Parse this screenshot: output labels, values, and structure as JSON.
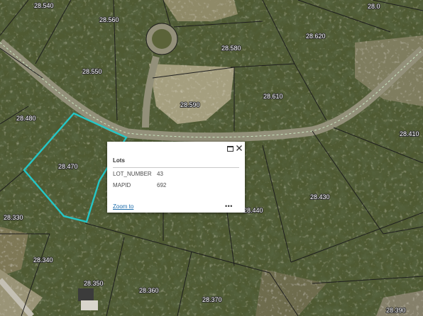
{
  "map": {
    "parcel_labels": [
      "28.540",
      "28.560",
      "28.0",
      "28.620",
      "28.580",
      "28.550",
      "28.610",
      "28.590",
      "28.480",
      "28.410",
      "28.470",
      "28.430",
      "28.440",
      "28.330",
      "28.340",
      "28.350",
      "28.360",
      "28.370",
      "28.390"
    ],
    "colors": {
      "highlight": "#24c7c7",
      "parcel_line": "#1e1e1e",
      "road_line": "#c9e6c0",
      "forest_dark": "#2f3a1f",
      "clearing": "#b9ae8c"
    }
  },
  "popup": {
    "title": "Lots",
    "attributes": [
      {
        "name": "LOT_NUMBER",
        "value": "43"
      },
      {
        "name": "MAPID",
        "value": "692"
      }
    ],
    "zoom_link": "Zoom to",
    "more_label": "•••",
    "maximize_icon": "maximize-icon",
    "close_icon": "close-icon"
  }
}
